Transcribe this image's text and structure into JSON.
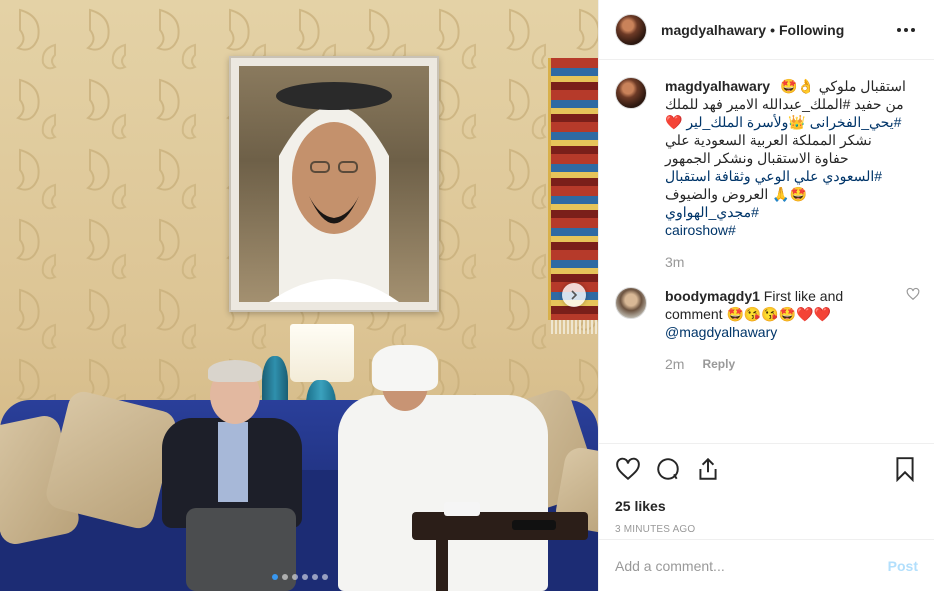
{
  "post": {
    "username": "magdyalhawary",
    "separator": "•",
    "follow_status": "Following",
    "more_icon": "more-options-icon",
    "caption_lines": [
      {
        "text": "استقبال ملوكي 👌🤩"
      },
      {
        "text": "من حفيد #الملك_عبدالله الامير فهد للملك"
      },
      {
        "text": "#يحي_الفخرانى 👑ولأسرة الملك_لير ❤️"
      },
      {
        "text": "نشكر المملكة العربية السعودية علي"
      },
      {
        "text": "حفاوة الاستقبال ونشكر الجمهور"
      },
      {
        "text": "#السعودي علي الوعي وثقافة استقبال"
      },
      {
        "text": "🤩🙏 العروض والضيوف"
      },
      {
        "text": "#مجدي_الهواوي"
      },
      {
        "text": "#cairoshow"
      }
    ],
    "caption_time": "3m",
    "comments": [
      {
        "username": "boodymagdy1",
        "text": "First like and comment 🤩😘😘🤩❤️❤️",
        "mention": "@magdyalhawary",
        "time": "2m",
        "reply_label": "Reply"
      }
    ],
    "likes": "25 likes",
    "timestamp": "3 minutes ago",
    "add_comment_placeholder": "Add a comment...",
    "post_button": "Post",
    "carousel": {
      "count": 6,
      "active": 0
    },
    "colors": {
      "link": "#003569",
      "muted": "#999999",
      "post_disabled": "#b2dffc",
      "dot_active": "#3897f0"
    },
    "icons": [
      "heart-icon",
      "comment-icon",
      "share-icon",
      "bookmark-icon",
      "next-arrow-icon"
    ]
  }
}
